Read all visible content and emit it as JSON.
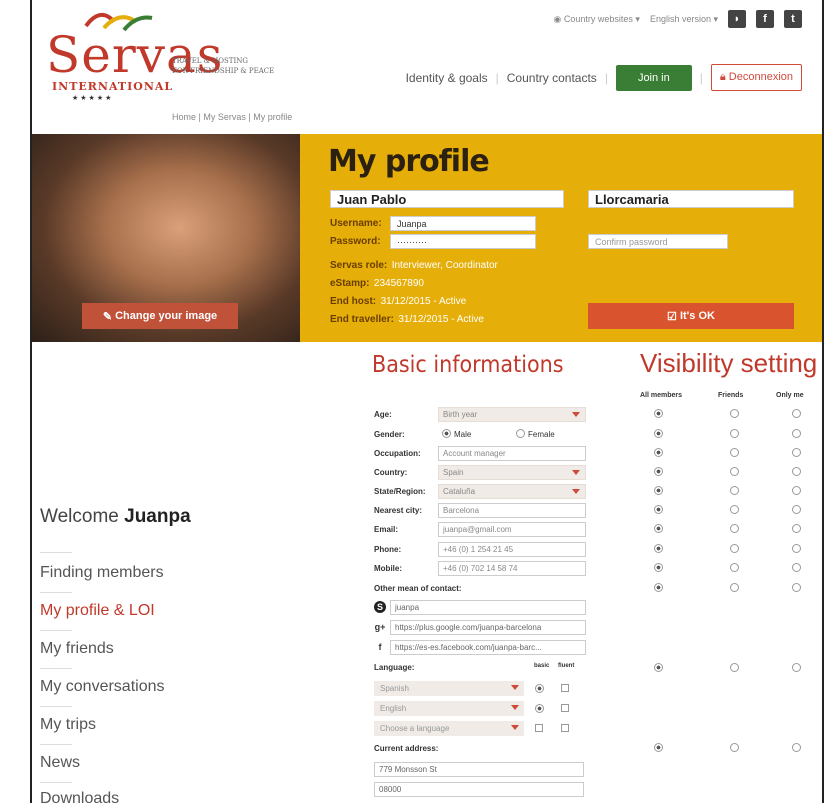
{
  "brand": {
    "name": "Servas",
    "subtitle": "INTERNATIONAL",
    "stars": "★★★★★",
    "tagline_1": "Travel & Hosting",
    "tagline_2": "for friendship & peace"
  },
  "topbar": {
    "country_websites": "Country websites ▾",
    "english_version": "English version ▾"
  },
  "nav": {
    "identity_goals": "Identity & goals",
    "country_contacts": "Country contacts",
    "join_in": "Join in",
    "deconnexion": "Deconnexion"
  },
  "breadcrumb": {
    "home": "Home",
    "my_servas": "My Servas",
    "my_profile": "My profile"
  },
  "profile": {
    "title": "My profile",
    "first_name": "Juan Pablo",
    "last_name": "Llorcamaria",
    "username_label": "Username:",
    "username": "Juanpa",
    "password_label": "Password:",
    "password": "··········",
    "confirm_password_placeholder": "Confirm password",
    "role_label": "Servas role:",
    "role": "Interviewer, Coordinator",
    "estamp_label": "eStamp:",
    "estamp": "234567890",
    "end_host_label": "End host:",
    "end_host": "31/12/2015 - Active",
    "end_traveller_label": "End traveller:",
    "end_traveller": "31/12/2015 - Active",
    "change_image": "Change your image",
    "ok_button": "It's OK"
  },
  "sidebar": {
    "welcome": "Welcome",
    "user": "Juanpa",
    "items": [
      {
        "label": "Finding members"
      },
      {
        "label": "My profile & LOI"
      },
      {
        "label": "My friends"
      },
      {
        "label": "My conversations"
      },
      {
        "label": "My trips"
      },
      {
        "label": "News"
      },
      {
        "label": "Downloads"
      }
    ]
  },
  "basic": {
    "title": "Basic informations",
    "age_label": "Age:",
    "age_placeholder": "Birth year",
    "gender_label": "Gender:",
    "male": "Male",
    "female": "Female",
    "occupation_label": "Occupation:",
    "occupation": "Account manager",
    "country_label": "Country:",
    "country": "Spain",
    "state_label": "State/Region:",
    "state": "Cataluña",
    "city_label": "Nearest city:",
    "city": "Barcelona",
    "email_label": "Email:",
    "email": "juanpa@gmail.com",
    "phone_label": "Phone:",
    "phone": "+46 (0) 1 254 21 45",
    "mobile_label": "Mobile:",
    "mobile": "+46 (0) 702 14 58 74",
    "other_contact_label": "Other mean of contact:",
    "skype": "juanpa",
    "gplus": "https://plus.google.com/juanpa-barcelona",
    "facebook": "https://es-es.facebook.com/juanpa-barc...",
    "language_label": "Language:",
    "basic_col": "basic",
    "fluent_col": "fluent",
    "languages": [
      "Spanish",
      "English",
      "Choose a language"
    ],
    "address_label": "Current address:",
    "address_line1": "779 Monsson St",
    "address_line2": "08000"
  },
  "visibility": {
    "title": "Visibility setting",
    "all_members": "All members",
    "friends": "Friends",
    "only_me": "Only me"
  }
}
